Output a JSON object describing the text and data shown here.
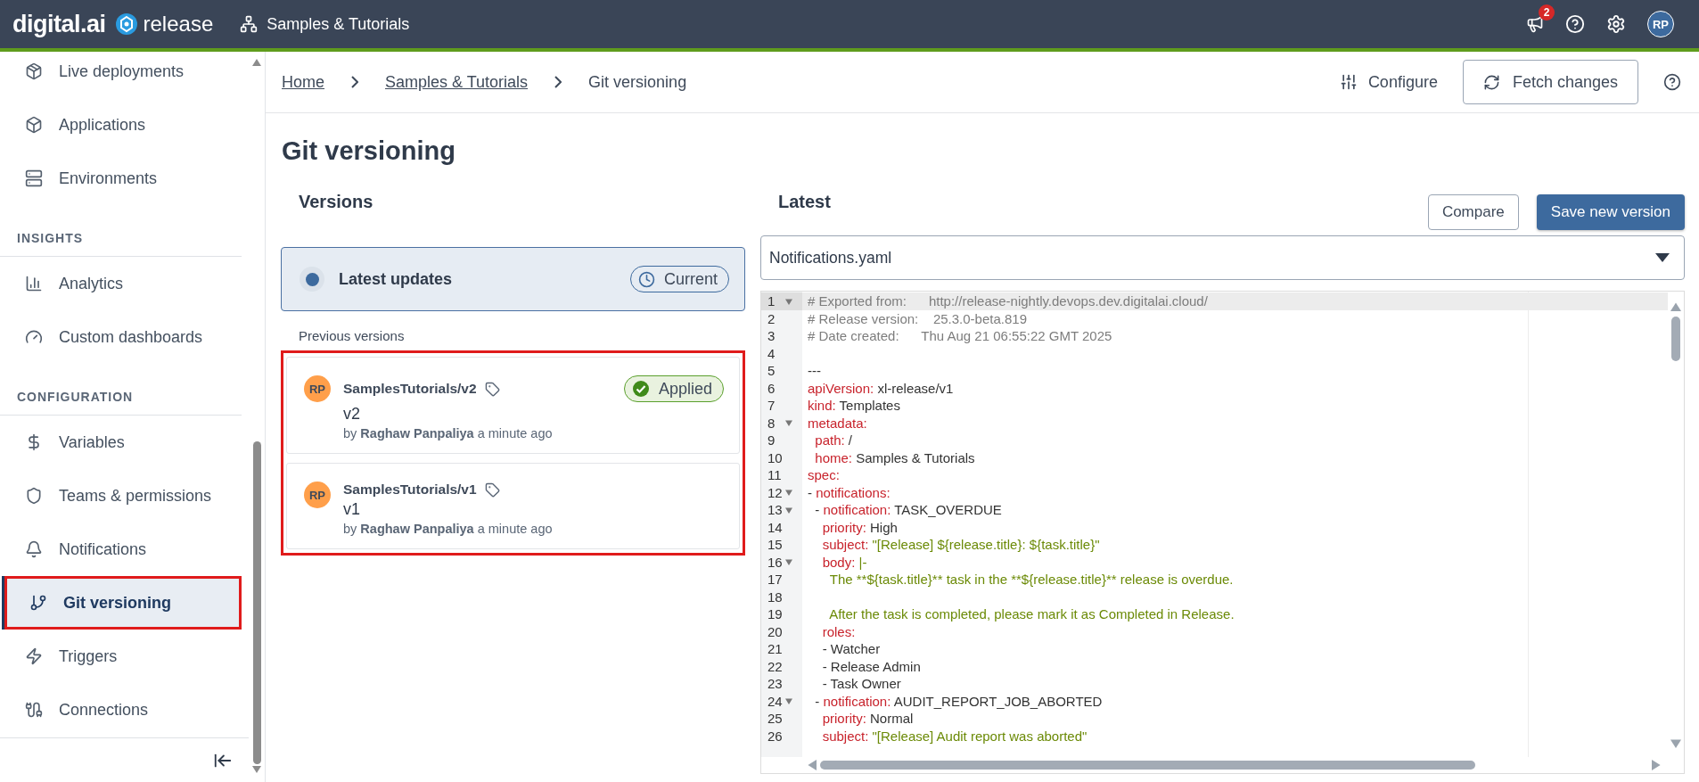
{
  "top_bar": {
    "brand": "digital.ai",
    "product": "release",
    "folder": "Samples & Tutorials",
    "notifications_badge": "2",
    "avatar": "RP"
  },
  "sidebar": {
    "items": [
      {
        "kind": "item",
        "label": "Live deployments",
        "selected": false,
        "highlighted": false
      },
      {
        "kind": "item",
        "label": "Applications",
        "selected": false,
        "highlighted": false
      },
      {
        "kind": "item",
        "label": "Environments",
        "selected": false,
        "highlighted": false
      },
      {
        "kind": "section",
        "label": "INSIGHTS"
      },
      {
        "kind": "item",
        "label": "Analytics",
        "selected": false,
        "highlighted": false
      },
      {
        "kind": "item",
        "label": "Custom dashboards",
        "selected": false,
        "highlighted": false
      },
      {
        "kind": "section",
        "label": "CONFIGURATION"
      },
      {
        "kind": "item",
        "label": "Variables",
        "selected": false,
        "highlighted": false
      },
      {
        "kind": "item",
        "label": "Teams & permissions",
        "selected": false,
        "highlighted": false
      },
      {
        "kind": "item",
        "label": "Notifications",
        "selected": false,
        "highlighted": false
      },
      {
        "kind": "item",
        "label": "Git versioning",
        "selected": true,
        "highlighted": true
      },
      {
        "kind": "item",
        "label": "Triggers",
        "selected": false,
        "highlighted": false
      },
      {
        "kind": "item",
        "label": "Connections",
        "selected": false,
        "highlighted": false
      }
    ]
  },
  "breadcrumbs": [
    {
      "label": "Home",
      "link": true
    },
    {
      "label": "Samples & Tutorials",
      "link": true
    },
    {
      "label": "Git versioning",
      "link": false
    }
  ],
  "header_actions": {
    "configure": "Configure",
    "fetch": "Fetch changes"
  },
  "page_title": "Git versioning",
  "versions": {
    "heading": "Versions",
    "latest": {
      "title": "Latest updates",
      "badge": "Current",
      "selected": true
    },
    "previous_label": "Previous versions",
    "highlighted": true,
    "items": [
      {
        "avatar": "RP",
        "name": "SamplesTutorials/v2",
        "message": "v2",
        "byline": "by **Raghaw Panpaliya** a minute ago",
        "badge": "Applied",
        "selected": false
      },
      {
        "avatar": "RP",
        "name": "SamplesTutorials/v1",
        "message": "v1",
        "byline": "by **Raghaw Panpaliya** a minute ago",
        "selected": false
      }
    ]
  },
  "latest": {
    "heading": "Latest",
    "compare": "Compare",
    "save": "Save new version",
    "file": "Notifications.yaml",
    "lines": [
      {
        "number": "1",
        "active": true,
        "foldable": true,
        "parts": [
          {
            "kind": "comment",
            "text": "# Exported from:      http://release-nightly.devops.dev.digitalai.cloud/"
          }
        ]
      },
      {
        "number": "2",
        "active": false,
        "foldable": false,
        "parts": [
          {
            "kind": "comment",
            "text": "# Release version:    25.3.0-beta.819"
          }
        ]
      },
      {
        "number": "3",
        "active": false,
        "foldable": false,
        "parts": [
          {
            "kind": "comment",
            "text": "# Date created:      Thu Aug 21 06:55:22 GMT 2025"
          }
        ]
      },
      {
        "number": "4",
        "active": false,
        "foldable": false
      },
      {
        "number": "5",
        "active": false,
        "foldable": false,
        "parts": [
          {
            "kind": "plain",
            "text": "---"
          }
        ]
      },
      {
        "number": "6",
        "active": false,
        "foldable": false,
        "parts": [
          {
            "kind": "key",
            "text": "apiVersion:"
          },
          {
            "kind": "plain",
            "text": " xl-release/v1"
          }
        ]
      },
      {
        "number": "7",
        "active": false,
        "foldable": false,
        "parts": [
          {
            "kind": "key",
            "text": "kind:"
          },
          {
            "kind": "plain",
            "text": " Templates"
          }
        ]
      },
      {
        "number": "8",
        "active": false,
        "foldable": true,
        "parts": [
          {
            "kind": "key",
            "text": "metadata:"
          }
        ]
      },
      {
        "number": "9",
        "active": false,
        "foldable": false,
        "parts": [
          {
            "kind": "key",
            "text": "  path:"
          },
          {
            "kind": "plain",
            "text": " /"
          }
        ]
      },
      {
        "number": "10",
        "active": false,
        "foldable": false,
        "parts": [
          {
            "kind": "key",
            "text": "  home:"
          },
          {
            "kind": "plain",
            "text": " Samples & Tutorials"
          }
        ]
      },
      {
        "number": "11",
        "active": false,
        "foldable": false,
        "parts": [
          {
            "kind": "key",
            "text": "spec:"
          }
        ]
      },
      {
        "number": "12",
        "active": false,
        "foldable": true,
        "parts": [
          {
            "kind": "plain",
            "text": "- "
          },
          {
            "kind": "key",
            "text": "notifications:"
          }
        ]
      },
      {
        "number": "13",
        "active": false,
        "foldable": true,
        "parts": [
          {
            "kind": "plain",
            "text": "  - "
          },
          {
            "kind": "key",
            "text": "notification:"
          },
          {
            "kind": "plain",
            "text": " TASK_OVERDUE"
          }
        ]
      },
      {
        "number": "14",
        "active": false,
        "foldable": false,
        "parts": [
          {
            "kind": "key",
            "text": "    priority:"
          },
          {
            "kind": "plain",
            "text": " High"
          }
        ]
      },
      {
        "number": "15",
        "active": false,
        "foldable": false,
        "parts": [
          {
            "kind": "key",
            "text": "    subject:"
          },
          {
            "kind": "string",
            "text": " \"[Release] ${release.title}: ${task.title}\""
          }
        ]
      },
      {
        "number": "16",
        "active": false,
        "foldable": true,
        "parts": [
          {
            "kind": "key",
            "text": "    body:"
          },
          {
            "kind": "string",
            "text": " |-"
          }
        ]
      },
      {
        "number": "17",
        "active": false,
        "foldable": false,
        "parts": [
          {
            "kind": "string",
            "text": "      The **${task.title}** task in the **${release.title}** release is overdue."
          }
        ]
      },
      {
        "number": "18",
        "active": false,
        "foldable": false
      },
      {
        "number": "19",
        "active": false,
        "foldable": false,
        "parts": [
          {
            "kind": "string",
            "text": "      After the task is completed, please mark it as Completed in Release."
          }
        ]
      },
      {
        "number": "20",
        "active": false,
        "foldable": false,
        "parts": [
          {
            "kind": "key",
            "text": "    roles:"
          }
        ]
      },
      {
        "number": "21",
        "active": false,
        "foldable": false,
        "parts": [
          {
            "kind": "plain",
            "text": "    - Watcher"
          }
        ]
      },
      {
        "number": "22",
        "active": false,
        "foldable": false,
        "parts": [
          {
            "kind": "plain",
            "text": "    - Release Admin"
          }
        ]
      },
      {
        "number": "23",
        "active": false,
        "foldable": false,
        "parts": [
          {
            "kind": "plain",
            "text": "    - Task Owner"
          }
        ]
      },
      {
        "number": "24",
        "active": false,
        "foldable": true,
        "parts": [
          {
            "kind": "plain",
            "text": "  - "
          },
          {
            "kind": "key",
            "text": "notification:"
          },
          {
            "kind": "plain",
            "text": " AUDIT_REPORT_JOB_ABORTED"
          }
        ]
      },
      {
        "number": "25",
        "active": false,
        "foldable": false,
        "parts": [
          {
            "kind": "key",
            "text": "    priority:"
          },
          {
            "kind": "plain",
            "text": " Normal"
          }
        ]
      },
      {
        "number": "26",
        "active": false,
        "foldable": false,
        "parts": [
          {
            "kind": "key",
            "text": "    subject:"
          },
          {
            "kind": "string",
            "text": " \"[Release] Audit report was aborted\""
          }
        ]
      }
    ]
  }
}
